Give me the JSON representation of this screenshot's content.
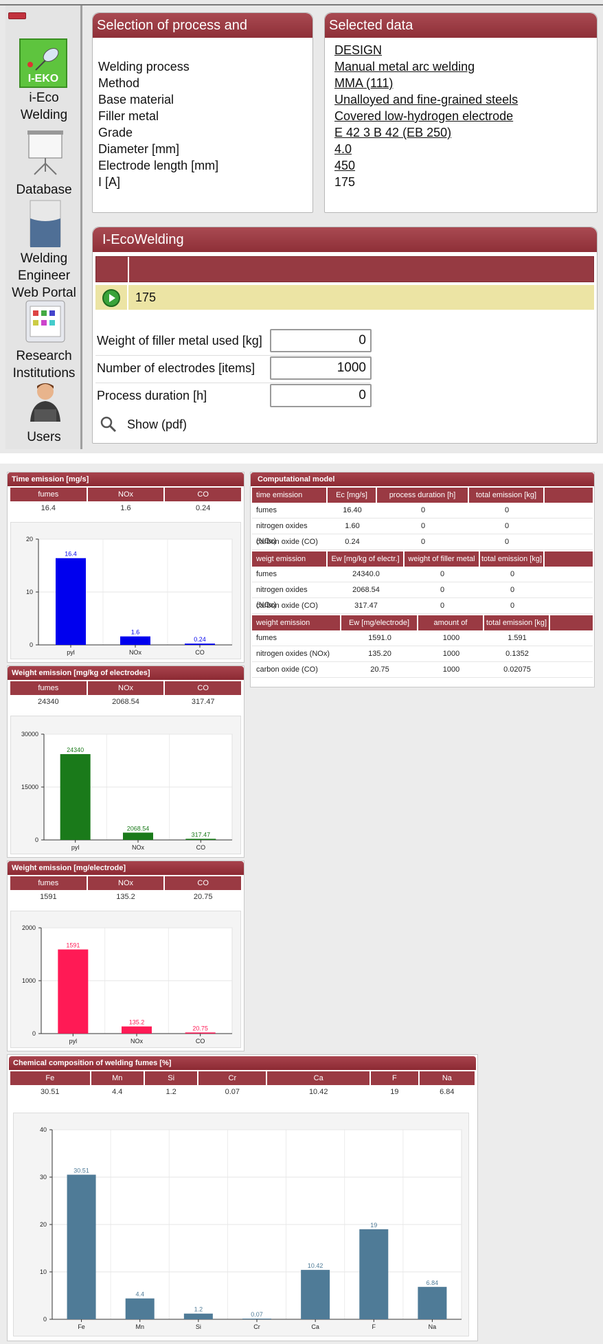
{
  "sidebar": {
    "items": [
      {
        "label": "i-Eco Welding",
        "icon": "i-eko-logo-icon",
        "badge": "I-EKO"
      },
      {
        "label": "Database",
        "icon": "projector-screen-icon"
      },
      {
        "label": "Welding Engineer Web Portal",
        "icon": "binder-icon"
      },
      {
        "label": "Research Institutions",
        "icon": "spreadsheet-icon"
      },
      {
        "label": "Users",
        "icon": "user-laptop-icon"
      }
    ]
  },
  "selection": {
    "title": "Selection of process and conditions",
    "labels": [
      "Welding process",
      "Method",
      "Base material",
      "Filler metal",
      "Grade",
      "Diameter [mm]",
      "Electrode length [mm]",
      "I [A]"
    ]
  },
  "selected": {
    "title": "Selected data",
    "values": [
      "DESIGN",
      "Manual metal arc welding",
      "MMA (111)",
      "Unalloyed and fine-grained steels",
      "Covered low-hydrogen electrode",
      "E 42 3 B 42 (EB 250)",
      "4.0",
      "450",
      "175"
    ]
  },
  "eco": {
    "title": "I-EcoWelding",
    "current_value": "175",
    "fields": [
      {
        "label": "Weight of filler metal used [kg]",
        "value": "0"
      },
      {
        "label": "Number of electrodes [items]",
        "value": "1000"
      },
      {
        "label": "Process duration [h]",
        "value": "0"
      }
    ],
    "show_pdf": "Show (pdf)"
  },
  "time_emission": {
    "title": "Time emission [mg/s]",
    "headers": [
      "fumes",
      "NOx",
      "CO"
    ],
    "values": [
      "16.4",
      "1.6",
      "0.24"
    ],
    "color": "#0000ee"
  },
  "weight_emission_kg": {
    "title": "Weight emission [mg/kg of electrodes]",
    "headers": [
      "fumes",
      "NOx",
      "CO"
    ],
    "values": [
      "24340",
      "2068.54",
      "317.47"
    ],
    "color": "#1a7a1a"
  },
  "weight_emission_el": {
    "title": "Weight emission [mg/electrode]",
    "headers": [
      "fumes",
      "NOx",
      "CO"
    ],
    "values": [
      "1591",
      "135.2",
      "20.75"
    ],
    "color": "#ff1a55"
  },
  "computational": {
    "title": "Computational model",
    "sections": [
      {
        "headers": [
          "time emission",
          "Ec [mg/s]",
          "process duration [h]",
          "total emission [kg]"
        ],
        "rows": [
          [
            "fumes",
            "16.40",
            "0",
            "0"
          ],
          [
            "nitrogen oxides (NOx)",
            "1.60",
            "0",
            "0"
          ],
          [
            "carbon oxide (CO)",
            "0.24",
            "0",
            "0"
          ]
        ]
      },
      {
        "headers": [
          "weigt emission",
          "Ew [mg/kg of electr.]",
          "weight of filler metal [kg]",
          "total emission [kg]"
        ],
        "rows": [
          [
            "fumes",
            "24340.0",
            "0",
            "0"
          ],
          [
            "nitrogen oxides (NOx)",
            "2068.54",
            "0",
            "0"
          ],
          [
            "carbon oxide (CO)",
            "317.47",
            "0",
            "0"
          ]
        ]
      },
      {
        "headers": [
          "weight emission",
          "Ew [mg/electrode]",
          "amount of eletctrodes",
          "total emission [kg]"
        ],
        "rows": [
          [
            "fumes",
            "1591.0",
            "1000",
            "1.591"
          ],
          [
            "nitrogen oxides (NOx)",
            "135.20",
            "1000",
            "0.1352"
          ],
          [
            "carbon oxide (CO)",
            "20.75",
            "1000",
            "0.02075"
          ]
        ]
      }
    ]
  },
  "chemical": {
    "title": "Chemical composition of welding fumes [%]",
    "headers": [
      "Fe",
      "Mn",
      "Si",
      "Cr",
      "Ca",
      "F",
      "Na"
    ],
    "values": [
      "30.51",
      "4.4",
      "1.2",
      "0.07",
      "10.42",
      "19",
      "6.84"
    ],
    "color": "#4f7b97"
  },
  "chart_data": [
    {
      "type": "bar",
      "title": "Time emission [mg/s]",
      "categories": [
        "pyl",
        "NOx",
        "CO"
      ],
      "values": [
        16.4,
        1.6,
        0.24
      ],
      "value_labels": [
        "16.4",
        "1.6",
        "0.24"
      ],
      "ylim": [
        0,
        20
      ],
      "yticks": [
        "0",
        "10",
        "20"
      ],
      "color": "#0000ee",
      "grid": true
    },
    {
      "type": "bar",
      "title": "Weight emission [mg/kg of electrodes]",
      "categories": [
        "pyl",
        "NOx",
        "CO"
      ],
      "values": [
        24340,
        2068.54,
        317.47
      ],
      "value_labels": [
        "24340",
        "2068.54",
        "317.47"
      ],
      "ylim": [
        0,
        30000
      ],
      "yticks": [
        "0",
        "15000",
        "30000"
      ],
      "color": "#1a7a1a",
      "grid": true
    },
    {
      "type": "bar",
      "title": "Weight emission [mg/electrode]",
      "categories": [
        "pyl",
        "NOx",
        "CO"
      ],
      "values": [
        1591,
        135.2,
        20.75
      ],
      "value_labels": [
        "1591",
        "135.2",
        "20.75"
      ],
      "ylim": [
        0,
        2000
      ],
      "yticks": [
        "0",
        "1000",
        "2000"
      ],
      "color": "#ff1a55",
      "grid": true
    },
    {
      "type": "bar",
      "title": "Chemical composition of welding fumes [%]",
      "categories": [
        "Fe",
        "Mn",
        "Si",
        "Cr",
        "Ca",
        "F",
        "Na"
      ],
      "values": [
        30.51,
        4.4,
        1.2,
        0.07,
        10.42,
        19,
        6.84
      ],
      "value_labels": [
        "30.51",
        "4.4",
        "1.2",
        "0.07",
        "10.42",
        "19",
        "6.84"
      ],
      "ylim": [
        0,
        40
      ],
      "yticks": [
        "0",
        "10",
        "20",
        "30",
        "40"
      ],
      "color": "#4f7b97",
      "grid": true
    }
  ]
}
